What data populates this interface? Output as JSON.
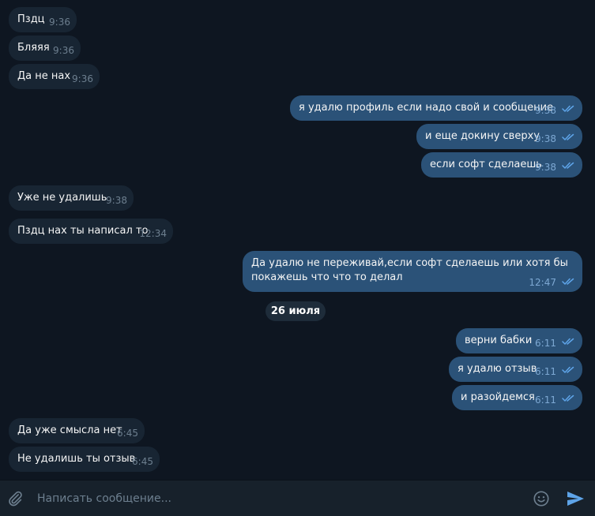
{
  "messages": [
    {
      "dir": "in",
      "text": "Пздц",
      "time": "9:36"
    },
    {
      "dir": "in",
      "text": "Бляяя",
      "time": "9:36"
    },
    {
      "dir": "in",
      "text": "Да не нах",
      "time": "9:36"
    },
    {
      "dir": "out",
      "text": "я удалю профиль если надо свой и сообщение",
      "time": "9:38"
    },
    {
      "dir": "out",
      "text": "и еще докину сверху",
      "time": "9:38"
    },
    {
      "dir": "out",
      "text": "если софт сделаешь",
      "time": "9:38"
    },
    {
      "dir": "in",
      "text": "Уже не удалишь",
      "time": "9:38"
    },
    {
      "dir": "in",
      "text": "Пздц нах ты написал то",
      "time": "12:34"
    },
    {
      "dir": "out",
      "text": "Да удалю не переживай,если софт сделаешь или хотя бы покажешь что что то делал",
      "time": "12:47"
    },
    {
      "dir": "out",
      "text": "верни бабки",
      "time": "6:11"
    },
    {
      "dir": "out",
      "text": "я удалю отзыв",
      "time": "6:11"
    },
    {
      "dir": "out",
      "text": "и разойдемся",
      "time": "6:11"
    },
    {
      "dir": "in",
      "text": "Да уже смысла нет",
      "time": "6:45"
    },
    {
      "dir": "in",
      "text": "Не удалишь ты отзыв",
      "time": "6:45"
    }
  ],
  "date_separator": "26 июля",
  "composer": {
    "placeholder": "Написать сообщение...",
    "attach_icon": "paperclip-icon",
    "emoji_icon": "smile-icon",
    "send_icon": "send-icon"
  },
  "colors": {
    "background": "#0e1621",
    "incoming_bubble": "#182533",
    "outgoing_bubble": "#2b5278",
    "composer_bg": "#17212b",
    "accent": "#5ea4e8"
  }
}
